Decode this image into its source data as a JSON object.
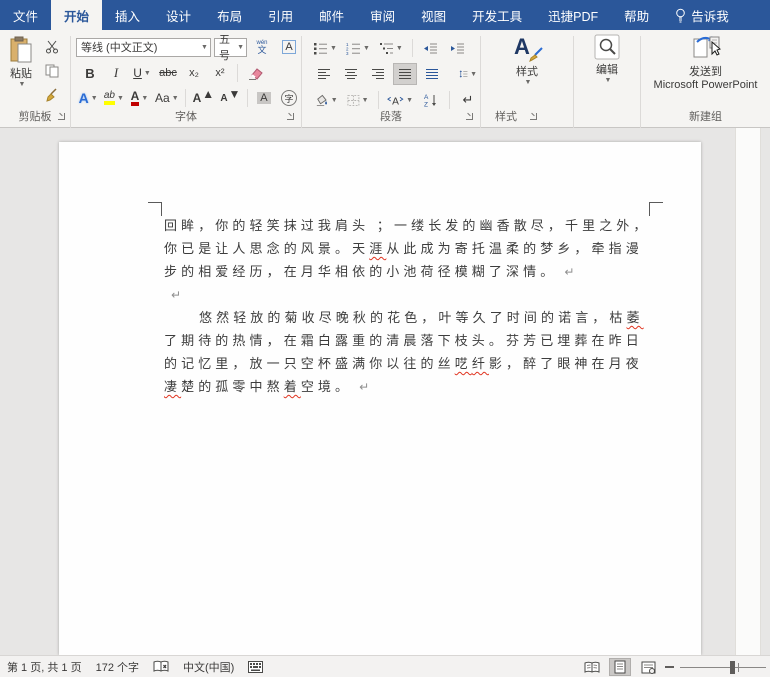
{
  "tabs": {
    "items": [
      {
        "key": "file",
        "label": "文件",
        "active": false
      },
      {
        "key": "home",
        "label": "开始",
        "active": true
      },
      {
        "key": "insert",
        "label": "插入",
        "active": false
      },
      {
        "key": "design",
        "label": "设计",
        "active": false
      },
      {
        "key": "layout",
        "label": "布局",
        "active": false
      },
      {
        "key": "references",
        "label": "引用",
        "active": false
      },
      {
        "key": "mailings",
        "label": "邮件",
        "active": false
      },
      {
        "key": "review",
        "label": "审阅",
        "active": false
      },
      {
        "key": "view",
        "label": "视图",
        "active": false
      },
      {
        "key": "developer",
        "label": "开发工具",
        "active": false
      },
      {
        "key": "pdf",
        "label": "迅捷PDF",
        "active": false
      },
      {
        "key": "help",
        "label": "帮助",
        "active": false
      },
      {
        "key": "tellme",
        "label": "告诉我",
        "active": false,
        "bulb": true
      }
    ]
  },
  "ribbon": {
    "clipboard": {
      "paste_label": "粘贴",
      "group_label": "剪贴板"
    },
    "font": {
      "name_value": "等线 (中文正文)",
      "size_value": "五号",
      "group_label": "字体",
      "bold": "B",
      "italic": "I",
      "underline": "U",
      "strikethrough": "abc",
      "subscript": "x₂",
      "superscript": "x²",
      "text_effects": "A",
      "highlight": "ab",
      "font_color": "A",
      "change_case": "Aa",
      "grow_font": "A",
      "shrink_font": "A",
      "shading": "A",
      "enclose": "字",
      "phonetic_top": "wén",
      "phonetic_bottom": "文",
      "char_border": "A"
    },
    "paragraph": {
      "group_label": "段落",
      "sort_a": "A",
      "sort_z": "Z",
      "show_marks": "↵",
      "asian_a": "A"
    },
    "styles": {
      "button_label": "样式",
      "group_label": "样式",
      "icon_letter": "A"
    },
    "editing": {
      "button_label": "编辑"
    },
    "new_group": {
      "line1": "发送到",
      "line2": "Microsoft PowerPoint",
      "group_label": "新建组"
    }
  },
  "document": {
    "lines": [
      {
        "indent": false,
        "segments": [
          {
            "t": "回眸，你的轻笑抹过我肩头 ；一缕长发的幽香散尽，千里之外，"
          }
        ]
      },
      {
        "indent": false,
        "segments": [
          {
            "t": "你已是让人思念的风景。天"
          },
          {
            "t": "涯",
            "err": true
          },
          {
            "t": "从此成为寄托温柔的梦乡，牵指漫"
          }
        ]
      },
      {
        "indent": false,
        "segments": [
          {
            "t": "步的相爱经历，在月华相依的小池荷径模糊了深情。"
          },
          {
            "t": "↵",
            "mark": true
          }
        ]
      },
      {
        "indent": false,
        "segments": [
          {
            "t": "↵",
            "mark": true
          }
        ]
      },
      {
        "indent": true,
        "segments": [
          {
            "t": "悠然轻放的菊收尽晚秋的花色，叶等久了时间的诺言，枯"
          },
          {
            "t": "萎",
            "err": true
          }
        ]
      },
      {
        "indent": false,
        "segments": [
          {
            "t": "了期待的热情，在霜白露重的清晨落下枝头。芬芳已埋葬在昨日"
          }
        ]
      },
      {
        "indent": false,
        "segments": [
          {
            "t": "的记忆里，放一只空杯盛满你以往的丝"
          },
          {
            "t": "呓",
            "err": true
          },
          {
            "t": "纤",
            "err": true
          },
          {
            "t": "影，醉了眼神在月夜"
          }
        ]
      },
      {
        "indent": false,
        "segments": [
          {
            "t": "凄",
            "err": true
          },
          {
            "t": "楚的孤零中熬"
          },
          {
            "t": "着",
            "err": true
          },
          {
            "t": "空境。"
          },
          {
            "t": "↵",
            "mark": true
          }
        ]
      }
    ]
  },
  "status_bar": {
    "page_indicator": "第 1 页, 共 1 页",
    "word_count": "172 个字",
    "language": "中文(中国)"
  },
  "colors": {
    "accent": "#2b579a",
    "font_color_bar": "#c00000",
    "highlight_bar": "#ffff00",
    "misspell_underline": "#e0331f"
  }
}
